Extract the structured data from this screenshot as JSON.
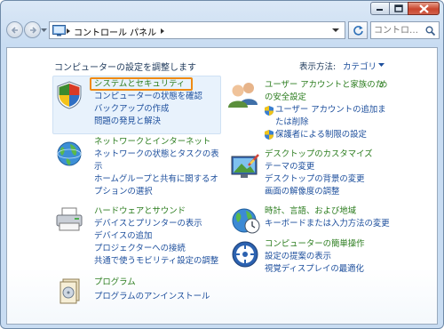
{
  "window": {
    "breadcrumb": "コントロール パネル",
    "search_placeholder": "コントロ…"
  },
  "content": {
    "heading": "コンピューターの設定を調整します",
    "view_by_label": "表示方法:",
    "view_by_value": "カテゴリ"
  },
  "categories": {
    "system": {
      "title": "システムとセキュリティ",
      "links": [
        "コンピューターの状態を確認",
        "バックアップの作成",
        "問題の発見と解決"
      ]
    },
    "network": {
      "title": "ネットワークとインターネット",
      "links": [
        "ネットワークの状態とタスクの表",
        "示",
        "ホームグループと共有に関するオ",
        "プションの選択"
      ]
    },
    "hardware": {
      "title": "ハードウェアとサウンド",
      "links": [
        "デバイスとプリンターの表示",
        "デバイスの追加",
        "プロジェクターへの接続",
        "共通で使うモビリティ設定の調整"
      ]
    },
    "programs": {
      "title": "プログラム",
      "links": [
        "プログラムのアンインストール"
      ]
    },
    "users": {
      "title": "ユーザー アカウントと家族のた",
      "title2": "め",
      "title3": "の安全設定",
      "links": [
        "ユーザー アカウントの追加ま",
        "たは削除",
        "保護者による制限の設定"
      ]
    },
    "appearance": {
      "title": "デスクトップのカスタマイズ",
      "links": [
        "テーマの変更",
        "デスクトップの背景の変更",
        "画面の解像度の調整"
      ]
    },
    "clock": {
      "title": "時計、言語、および地域",
      "links": [
        "キーボードまたは入力方法の変更"
      ]
    },
    "ease": {
      "title": "コンピューターの簡単操作",
      "links": [
        "設定の提案の表示",
        "視覚ディスプレイの最適化"
      ]
    }
  }
}
